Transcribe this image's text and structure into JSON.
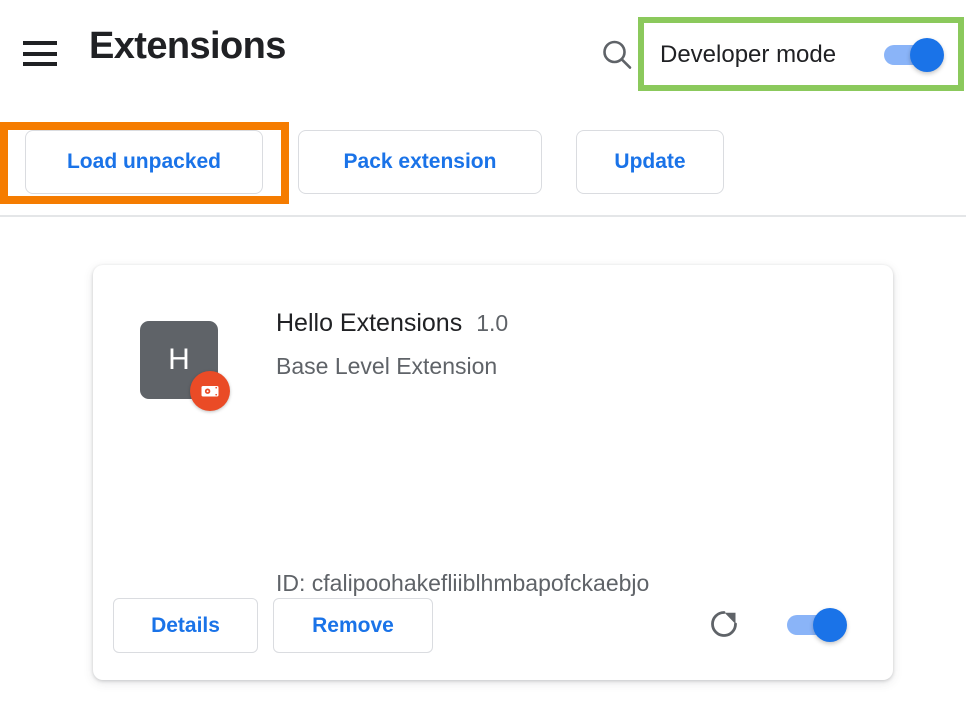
{
  "header": {
    "title": "Extensions",
    "menu_icon": "hamburger-menu-icon",
    "search_icon": "search-icon",
    "developer_mode": {
      "label": "Developer mode",
      "enabled": true,
      "highlight_color": "#8bc95c"
    }
  },
  "toolbar": {
    "load_unpacked_label": "Load unpacked",
    "pack_extension_label": "Pack extension",
    "update_label": "Update",
    "load_unpacked_highlight_color": "#f57c00"
  },
  "extension_card": {
    "icon_letter": "H",
    "icon_background": "#5f6368",
    "unpacked_badge_icon": "unpacked-extension-badge-icon",
    "unpacked_badge_color": "#ea4b26",
    "name": "Hello Extensions",
    "version": "1.0",
    "description": "Base Level Extension",
    "id_text": "ID: cfalipoohakefliiblhmbapofckaebjo",
    "details_label": "Details",
    "remove_label": "Remove",
    "reload_icon": "reload-icon",
    "enabled": true
  },
  "colors": {
    "accent_blue": "#1a73e8",
    "toggle_track": "#8ab4f8",
    "text_primary": "#202124",
    "text_secondary": "#5f6368",
    "border": "#dadce0"
  }
}
